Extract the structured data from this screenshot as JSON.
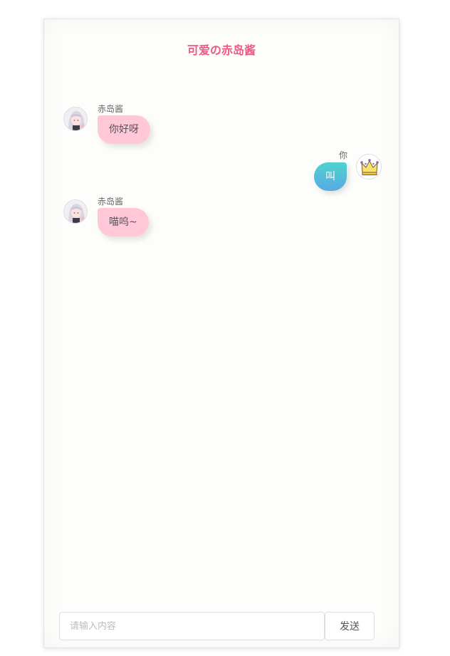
{
  "header": {
    "title": "可爱の赤岛酱"
  },
  "messages": [
    {
      "sender": "赤岛酱",
      "text": "你好呀",
      "side": "left"
    },
    {
      "sender": "你",
      "text": "叫",
      "side": "right"
    },
    {
      "sender": "赤岛酱",
      "text": "喵呜~",
      "side": "left"
    }
  ],
  "composer": {
    "placeholder": "请输入内容",
    "value": "",
    "send_label": "发送"
  },
  "colors": {
    "title": "#ea5b86",
    "bot_bubble": "#ffc7d7",
    "user_bubble_top": "#4fd3cc",
    "user_bubble_bottom": "#58a9e4"
  },
  "icons": {
    "bot_avatar": "anime-girl-avatar-icon",
    "user_avatar": "crown-icon"
  }
}
